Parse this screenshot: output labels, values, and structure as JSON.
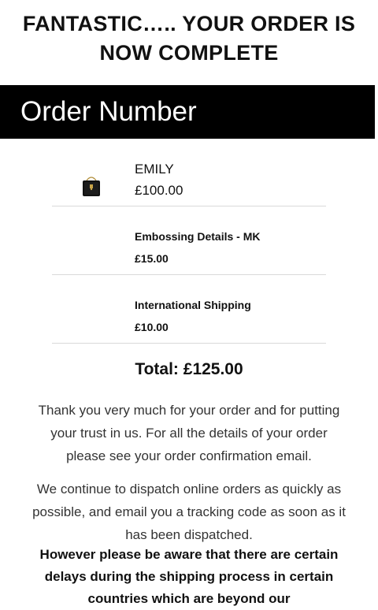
{
  "header": {
    "headline": "FANTASTIC….. YOUR ORDER IS NOW COMPLETE"
  },
  "order_bar": {
    "label": "Order Number"
  },
  "items": [
    {
      "name": "EMILY",
      "price": "£100.00",
      "thumbnail": "black-quilted-handbag"
    },
    {
      "name": "Embossing Details - MK",
      "price": "£15.00"
    },
    {
      "name": "International Shipping",
      "price": "£10.00"
    }
  ],
  "total": {
    "text": "Total: £125.00"
  },
  "messages": {
    "thanks": "Thank you very much for your order and for putting your trust in us. For all the details of your order please see your order confirmation email.",
    "dispatch": "We continue to dispatch online orders as quickly as possible, and email you a tracking code as soon as it has been dispatched.",
    "delay_warning": "However please be aware that there are certain delays during the shipping process in certain countries which are beyond our"
  },
  "colors": {
    "bar_background": "#000000",
    "bar_text": "#ffffff",
    "divider": "#d9d9d9"
  }
}
